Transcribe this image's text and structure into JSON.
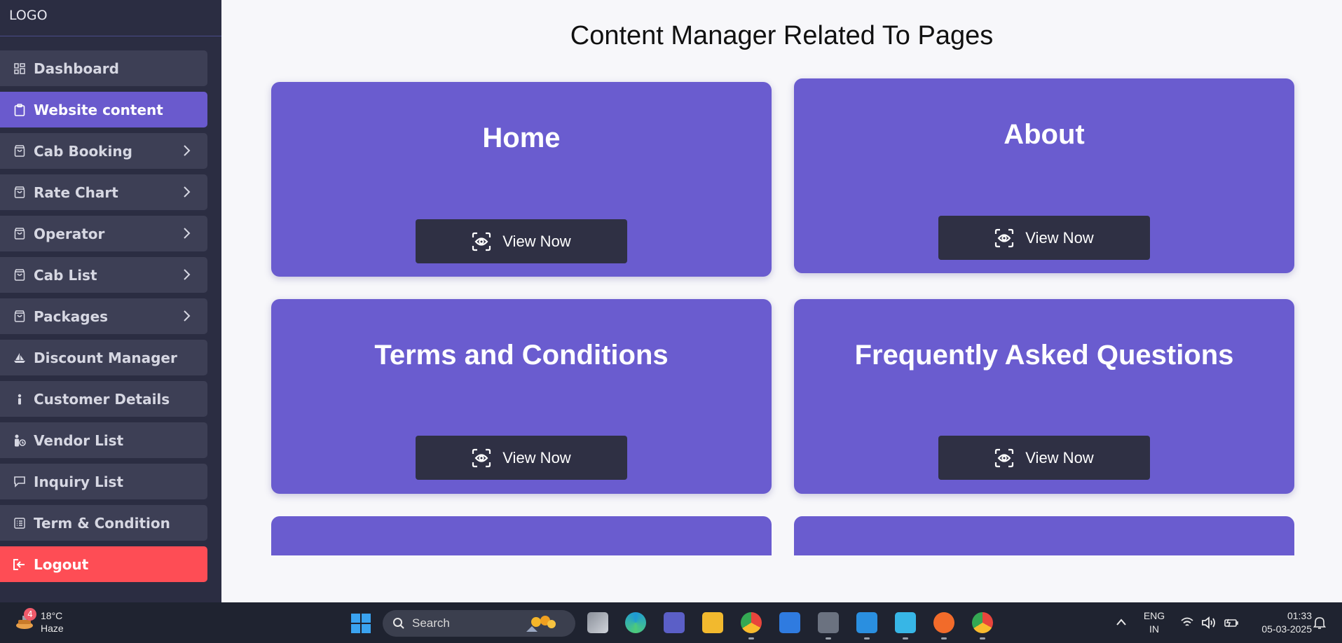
{
  "sidebar": {
    "logo": "LOGO",
    "items": [
      {
        "label": "Dashboard",
        "icon": "dashboard-icon",
        "chevron": false
      },
      {
        "label": "Website content",
        "icon": "clipboard-icon",
        "chevron": false,
        "active": true
      },
      {
        "label": "Cab Booking",
        "icon": "bag-icon",
        "chevron": true
      },
      {
        "label": "Rate Chart",
        "icon": "bag-icon",
        "chevron": true
      },
      {
        "label": "Operator",
        "icon": "bag-icon",
        "chevron": true
      },
      {
        "label": "Cab List",
        "icon": "bag-icon",
        "chevron": true
      },
      {
        "label": "Packages",
        "icon": "bag-icon",
        "chevron": true
      },
      {
        "label": "Discount Manager",
        "icon": "sailboat-icon",
        "chevron": false
      },
      {
        "label": "Customer Details",
        "icon": "person-icon",
        "chevron": false
      },
      {
        "label": "Vendor List",
        "icon": "vendor-icon",
        "chevron": false
      },
      {
        "label": "Inquiry List",
        "icon": "chat-icon",
        "chevron": false
      },
      {
        "label": "Term & Condition",
        "icon": "list-icon",
        "chevron": false
      }
    ],
    "logout": "Logout"
  },
  "main": {
    "title": "Content Manager Related To Pages",
    "cards": [
      {
        "title": "Home",
        "button": "View Now"
      },
      {
        "title": "About",
        "button": "View Now"
      },
      {
        "title": "Terms and Conditions",
        "button": "View Now"
      },
      {
        "title": "Frequently Asked Questions",
        "button": "View Now"
      }
    ]
  },
  "taskbar": {
    "weather": {
      "temp": "18°C",
      "condition": "Haze",
      "badge": "4"
    },
    "search_placeholder": "Search",
    "language": {
      "line1": "ENG",
      "line2": "IN"
    },
    "time": "01:33",
    "date": "05-03-2025"
  },
  "colors": {
    "sidebar_bg": "#2b2d42",
    "menu_item_bg": "#3d3f55",
    "active_item": "#6a5acd",
    "logout": "#fe4d55",
    "card": "#6a5ccf",
    "button": "#2f3044"
  }
}
